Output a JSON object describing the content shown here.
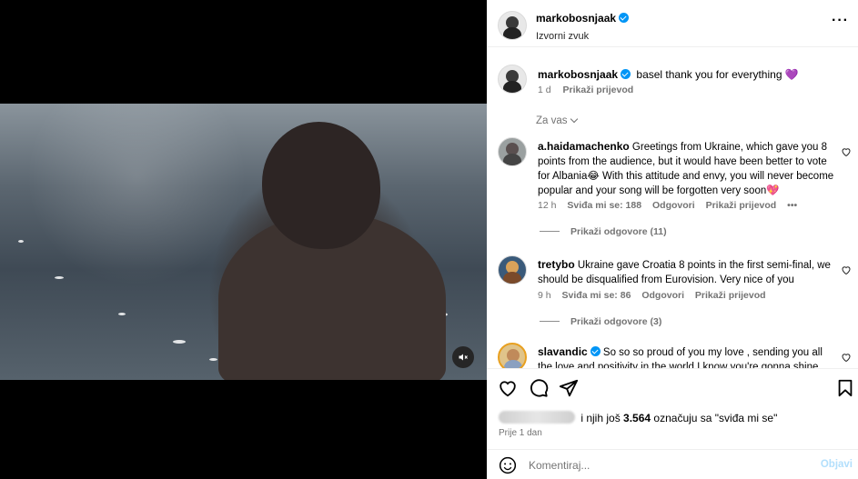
{
  "post": {
    "username": "markobosnjaak",
    "audio": "Izvorni zvuk",
    "caption": "basel thank you for everything 💜",
    "caption_time": "1 d",
    "translate": "Prikaži prijevod"
  },
  "filter": "Za vas",
  "comments": [
    {
      "username": "a.haidamachenko",
      "text": "Greetings from Ukraine, which gave you 8 points from the audience, but it would have been better to vote for Albania😂 With this attitude and envy, you will never become popular and your song will be forgotten very soon💖",
      "time": "12 h",
      "likes": "Sviđa mi se: 188",
      "reply": "Odgovori",
      "translate": "Prikaži prijevod",
      "more": "•••",
      "replies": "Prikaži odgovore (11)"
    },
    {
      "username": "tretybo",
      "text": "Ukraine gave Croatia 8 points in the first semi-final, we should be disqualified from Eurovision. Very nice of you",
      "time": "9 h",
      "likes": "Sviđa mi se: 86",
      "reply": "Odgovori",
      "translate": "Prikaži prijevod",
      "replies": "Prikaži odgovore (3)"
    },
    {
      "username": "slavandic",
      "text": "So so so proud of you my love , sending you all the love and positivity in the world I know you're gonna shine"
    }
  ],
  "likes_summary": {
    "prefix": "i njih još",
    "count": "3.564",
    "suffix": "označuju sa \"sviđa mi se\""
  },
  "time_ago": "Prije 1 dan",
  "comment_input": {
    "placeholder": "Komentiraj..."
  },
  "post_button": "Objavi",
  "colors": {
    "verified": "#0095f6",
    "link_blue_disabled": "#b2dffc"
  }
}
